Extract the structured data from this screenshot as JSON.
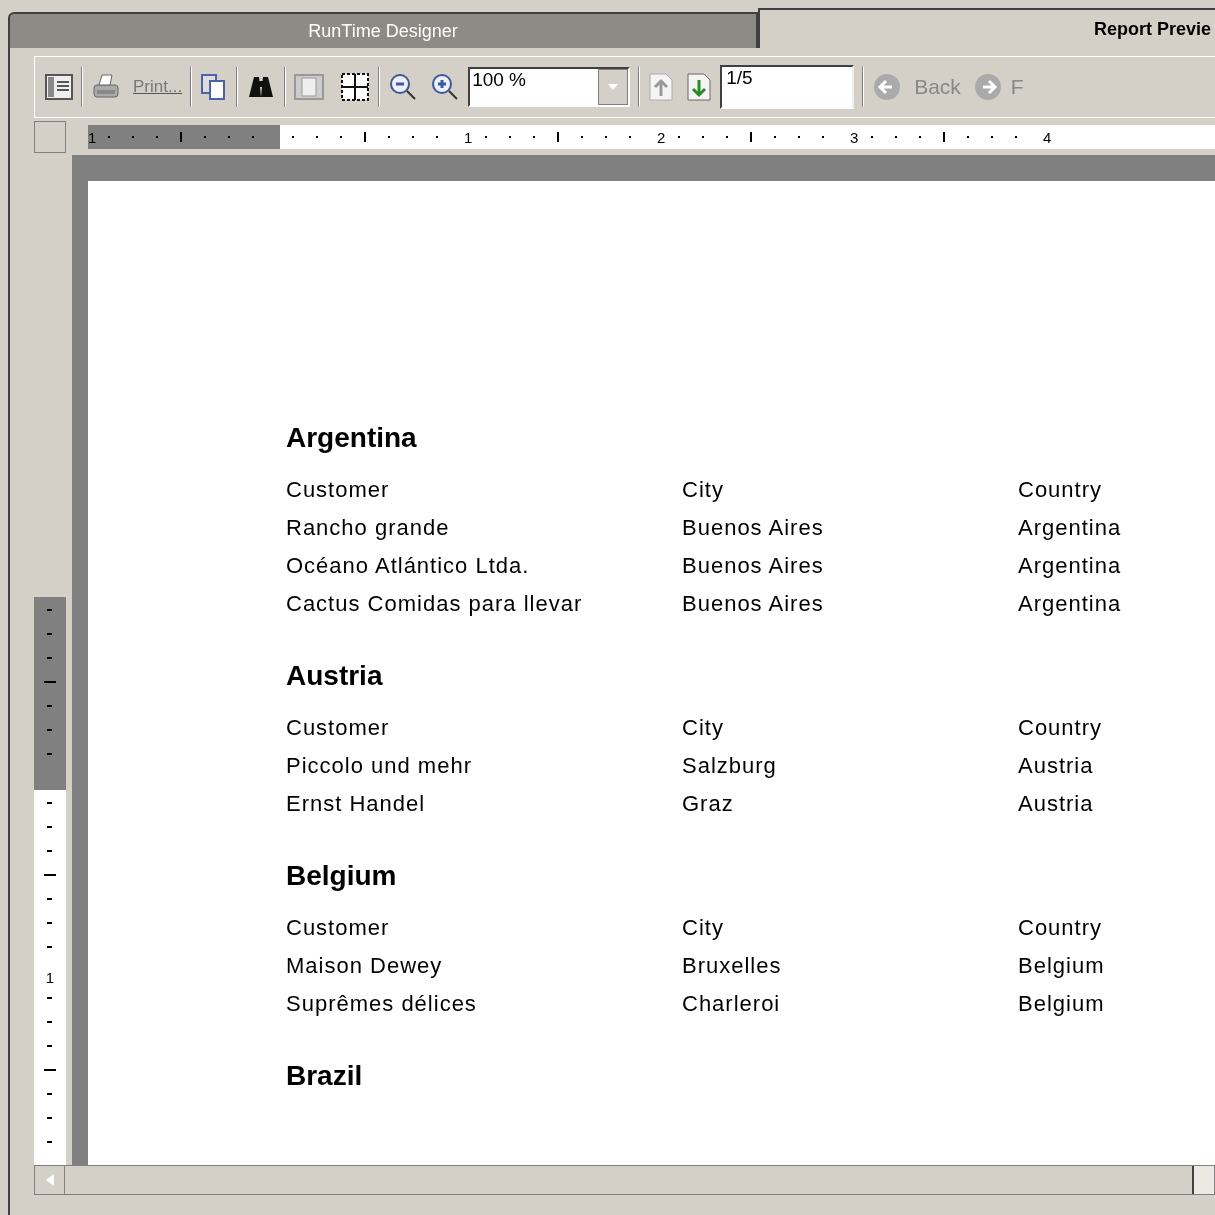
{
  "tabs": [
    {
      "label": "RunTime Designer",
      "selected": false
    },
    {
      "label": "Report Previe",
      "selected": true
    }
  ],
  "toolbar": {
    "print": "Print...",
    "zoom": "100 %",
    "page": "1/5",
    "back": "Back",
    "forward": "F"
  },
  "ruler": {
    "horizontal_labels": [
      "1",
      "1",
      "2",
      "3",
      "4"
    ],
    "vertical_labels": [
      "1"
    ]
  },
  "report": {
    "sections": [
      {
        "title": "Argentina",
        "columns": [
          "Customer",
          "City",
          "Country"
        ],
        "rows": [
          [
            "Rancho grande",
            "Buenos Aires",
            "Argentina"
          ],
          [
            "Océano Atlántico Ltda.",
            "Buenos Aires",
            "Argentina"
          ],
          [
            "Cactus Comidas para llevar",
            "Buenos Aires",
            "Argentina"
          ]
        ]
      },
      {
        "title": "Austria",
        "columns": [
          "Customer",
          "City",
          "Country"
        ],
        "rows": [
          [
            "Piccolo und mehr",
            "Salzburg",
            "Austria"
          ],
          [
            "Ernst Handel",
            "Graz",
            "Austria"
          ]
        ]
      },
      {
        "title": "Belgium",
        "columns": [
          "Customer",
          "City",
          "Country"
        ],
        "rows": [
          [
            "Maison Dewey",
            "Bruxelles",
            "Belgium"
          ],
          [
            "Suprêmes délices",
            "Charleroi",
            "Belgium"
          ]
        ]
      },
      {
        "title": "Brazil"
      }
    ]
  }
}
